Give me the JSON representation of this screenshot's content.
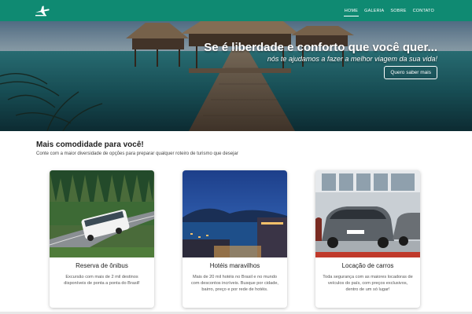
{
  "navbar": {
    "logo_icon": "airplane-icon",
    "items": [
      {
        "label": "HOME",
        "active": true
      },
      {
        "label": "GALERIA",
        "active": false
      },
      {
        "label": "SOBRE",
        "active": false
      },
      {
        "label": "CONTATO",
        "active": false
      }
    ],
    "color": "#0f8a72"
  },
  "hero": {
    "title": "Se é liberdade e conforto que você quer...",
    "subtitle": "nós te ajudamos a fazer a melhor viagem da sua vida!",
    "button_label": "Quero saber mais"
  },
  "section": {
    "title": "Mais comodidade para você!",
    "subtitle": "Conte com a maior diversidade de opções para preparar qualquer roteiro de turismo que desejar"
  },
  "cards": [
    {
      "title": "Reserva de ônibus",
      "text": "Excursão com mais de 2 mil destinos disponíveis de ponta a ponta do Brasil!",
      "image": "bus-on-mountain-road"
    },
    {
      "title": "Hotéis maravilhos",
      "text": "Mais de 20 mil hotéis no Brasil e no mundo com descontos incríveis. Busque por cidade, bairro, preço e por rede de hotéis.",
      "image": "seaside-hotel-at-dusk"
    },
    {
      "title": "Locação de carros",
      "text": "Toda segurança com as maiores locadoras de veículos do país, com preços exclusivos, dentro de um só lugar!",
      "image": "parked-rental-cars"
    }
  ]
}
